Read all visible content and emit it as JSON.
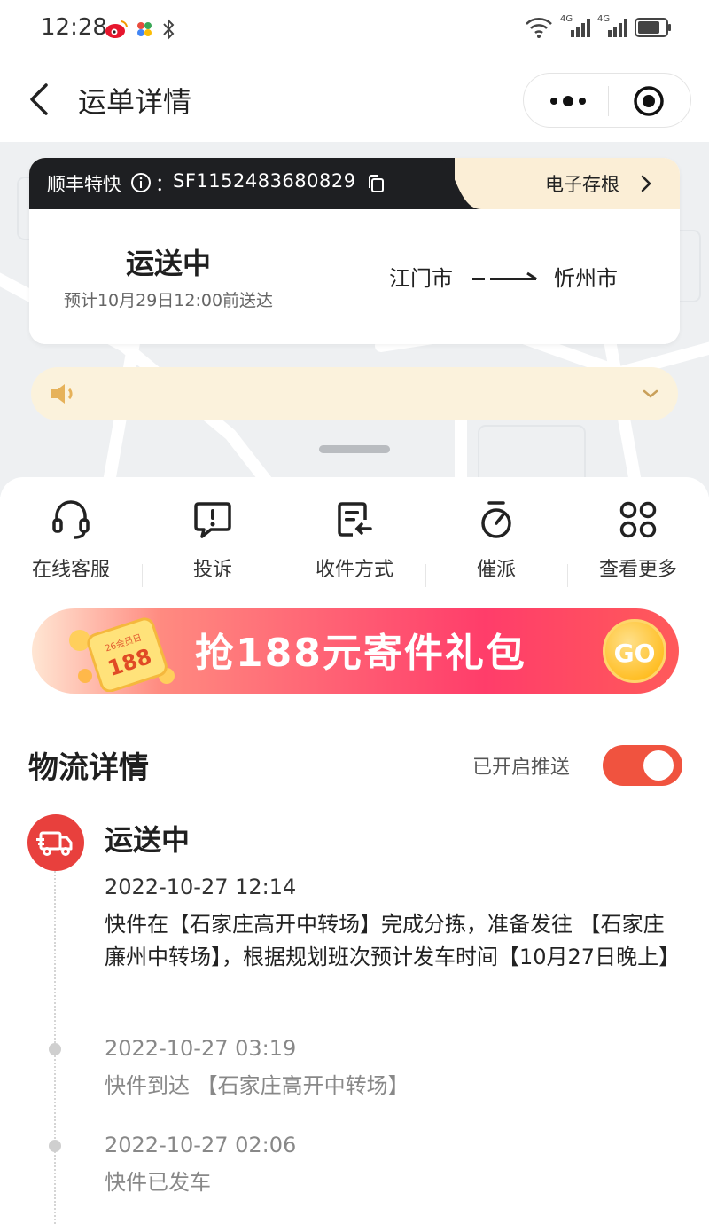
{
  "status_bar": {
    "time": "12:28",
    "left_icons": [
      "weibo-icon",
      "app-icon",
      "bluetooth-icon"
    ],
    "right_icons": [
      "wifi-icon",
      "signal-4g-icon",
      "signal-4g-icon",
      "battery-icon"
    ],
    "network_label_1": "4G",
    "network_label_2": "4G"
  },
  "header": {
    "title": "运单详情"
  },
  "waybill": {
    "service": "顺丰特快",
    "colon": "：",
    "number": "SF1152483680829",
    "receipt_label": "电子存根",
    "status": "运送中",
    "eta": "预计10月29日12:00前送达",
    "from": "江门市",
    "to": "忻州市"
  },
  "actions": [
    {
      "label": "在线客服",
      "icon": "headset-icon"
    },
    {
      "label": "投诉",
      "icon": "complaint-icon"
    },
    {
      "label": "收件方式",
      "icon": "receive-method-icon"
    },
    {
      "label": "催派",
      "icon": "stopwatch-icon"
    },
    {
      "label": "查看更多",
      "icon": "grid-icon"
    }
  ],
  "promo": {
    "text": "抢188元寄件礼包",
    "go_label": "GO",
    "gift_text": "188",
    "gift_caption": "26会员日"
  },
  "logistics": {
    "title": "物流详情",
    "push_label": "已开启推送",
    "push_enabled": true,
    "current_status": "运送中",
    "events": [
      {
        "time": "2022-10-27 12:14",
        "desc": "快件在【石家庄高开中转场】完成分拣，准备发往 【石家庄廉州中转场】，根据规划班次预计发车时间【10月27日晚上】"
      },
      {
        "time": "2022-10-27 03:19",
        "desc": "快件到达 【石家庄高开中转场】"
      },
      {
        "time": "2022-10-27 02:06",
        "desc": "快件已发车"
      }
    ]
  },
  "colors": {
    "accent_red": "#e8403d",
    "toggle_on": "#f0533f",
    "dark_banner": "#1e1f22",
    "banner_cream": "#fbeed6"
  }
}
